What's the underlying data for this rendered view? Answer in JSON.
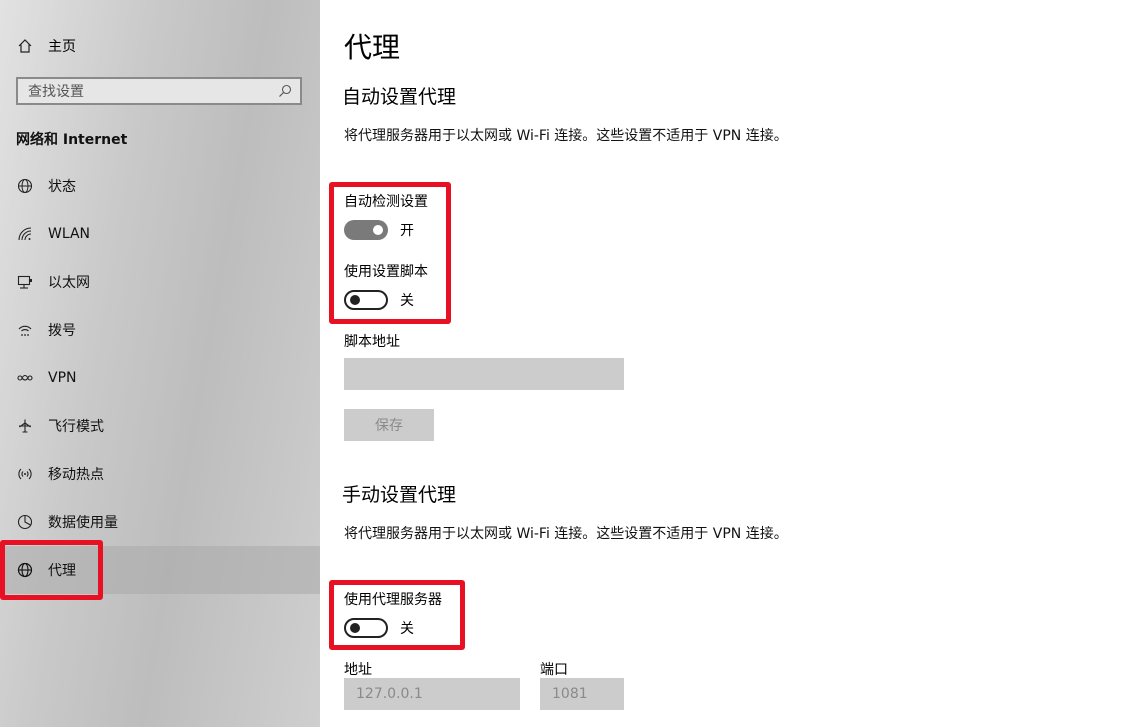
{
  "sidebar": {
    "home_label": "主页",
    "search_placeholder": "查找设置",
    "section_title": "网络和 Internet",
    "items": [
      {
        "label": "状态",
        "icon": "status-globe-icon"
      },
      {
        "label": "WLAN",
        "icon": "wifi-icon"
      },
      {
        "label": "以太网",
        "icon": "ethernet-icon"
      },
      {
        "label": "拨号",
        "icon": "dialup-icon"
      },
      {
        "label": "VPN",
        "icon": "vpn-icon"
      },
      {
        "label": "飞行模式",
        "icon": "airplane-icon"
      },
      {
        "label": "移动热点",
        "icon": "hotspot-icon"
      },
      {
        "label": "数据使用量",
        "icon": "data-usage-icon"
      },
      {
        "label": "代理",
        "icon": "globe-icon",
        "active": true
      }
    ]
  },
  "main": {
    "title": "代理",
    "auto": {
      "heading": "自动设置代理",
      "description": "将代理服务器用于以太网或 Wi-Fi 连接。这些设置不适用于 VPN 连接。",
      "detect_label": "自动检测设置",
      "detect_state": "开",
      "detect_on": true,
      "script_label": "使用设置脚本",
      "script_state": "关",
      "script_on": false,
      "address_label": "脚本地址",
      "address_value": "",
      "save_label": "保存"
    },
    "manual": {
      "heading": "手动设置代理",
      "description": "将代理服务器用于以太网或 Wi-Fi 连接。这些设置不适用于 VPN 连接。",
      "use_proxy_label": "使用代理服务器",
      "use_proxy_state": "关",
      "use_proxy_on": false,
      "address_label": "地址",
      "address_value": "127.0.0.1",
      "port_label": "端口",
      "port_value": "1081"
    }
  },
  "colors": {
    "highlight_red": "#e81123",
    "toggle_on": "#7a7a7a",
    "disabled_field": "#cccccc"
  }
}
